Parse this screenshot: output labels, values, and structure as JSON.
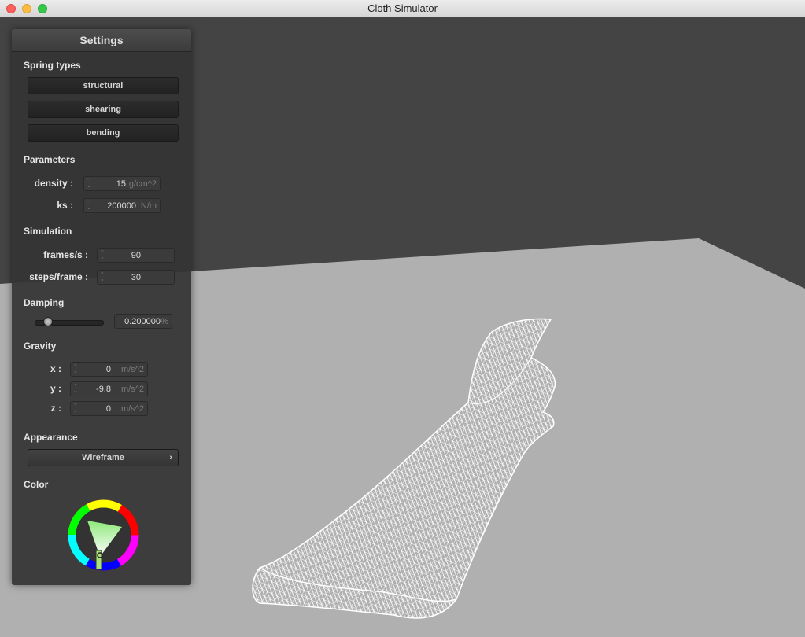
{
  "window": {
    "title": "Cloth Simulator"
  },
  "panel": {
    "title": "Settings",
    "spring_types": {
      "label": "Spring types",
      "buttons": [
        "structural",
        "shearing",
        "bending"
      ]
    },
    "parameters": {
      "label": "Parameters",
      "density": {
        "label": "density :",
        "value": "15",
        "unit": "g/cm^2"
      },
      "ks": {
        "label": "ks :",
        "value": "200000",
        "unit": "N/m"
      }
    },
    "simulation": {
      "label": "Simulation",
      "fps": {
        "label": "frames/s :",
        "value": "90"
      },
      "steps": {
        "label": "steps/frame :",
        "value": "30"
      }
    },
    "damping": {
      "label": "Damping",
      "value": "0.200000",
      "unit": "%",
      "level": 0.2
    },
    "gravity": {
      "label": "Gravity",
      "x": {
        "label": "x :",
        "value": "0",
        "unit": "m/s^2"
      },
      "y": {
        "label": "y :",
        "value": "-9.8",
        "unit": "m/s^2"
      },
      "z": {
        "label": "z :",
        "value": "0",
        "unit": "m/s^2"
      }
    },
    "appearance": {
      "label": "Appearance",
      "selected": "Wireframe",
      "chevron": "›"
    },
    "color": {
      "label": "Color",
      "current": "#b5e89a"
    }
  },
  "scene": {
    "background": "#444444",
    "plane_color": "#b0b0b0",
    "cloth_color": "#ffffff"
  }
}
